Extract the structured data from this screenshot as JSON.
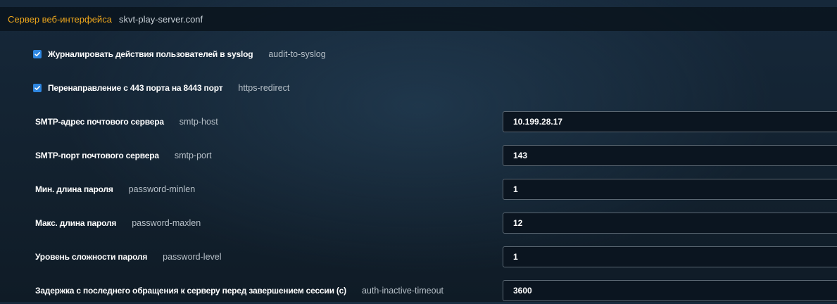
{
  "section": {
    "title": "Сервер веб-интерфейса",
    "key": "skvt-play-server.conf"
  },
  "checkbox_rows": [
    {
      "label": "Журналировать действия пользователей в syslog",
      "key": "audit-to-syslog",
      "checked": true
    },
    {
      "label": "Перенаправление с 443 порта на 8443 порт",
      "key": "https-redirect",
      "checked": true
    }
  ],
  "field_rows": [
    {
      "label": "SMTP-адрес почтового сервера",
      "key": "smtp-host",
      "value": "10.199.28.17"
    },
    {
      "label": "SMTP-порт почтового сервера",
      "key": "smtp-port",
      "value": "143"
    },
    {
      "label": "Мин. длина пароля",
      "key": "password-minlen",
      "value": "1"
    },
    {
      "label": "Макс. длина пароля",
      "key": "password-maxlen",
      "value": "12"
    },
    {
      "label": "Уровень сложности пароля",
      "key": "password-level",
      "value": "1"
    },
    {
      "label": "Задержка с последнего обращения к серверу перед завершением сессии (с)",
      "key": "auth-inactive-timeout",
      "value": "3600"
    }
  ],
  "colors": {
    "accent": "#f0a81c",
    "checkbox": "#2e86e0",
    "background": "#142331",
    "field_border": "#5b6772"
  },
  "icons": {
    "checkbox_checked": "checkmark-icon"
  }
}
